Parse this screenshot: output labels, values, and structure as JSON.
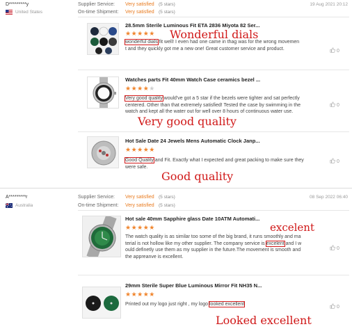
{
  "reviews": [
    {
      "buyer": "D*********y",
      "country": "United States",
      "supplier_label": "Supplier Service:",
      "supplier_value": "Very satisfied",
      "supplier_stars": "(5 stars)",
      "shipment_label": "On-time Shipment:",
      "shipment_value": "Very satisfied",
      "shipment_stars": "(5 stars)",
      "date": "19 Aug 2021 20:12",
      "items": [
        {
          "title": "28.5mm Sterile Luminous Fit ETA 2836 Miyota 82 Ser...",
          "rating": 5,
          "highlight": "wonderful dials",
          "text_after_line1": " fit well! I even had one came in thag was for the wrong movemen",
          "text_line2": "t and they quickly got me a new one! Great customer service and product.",
          "annotation": "Wonderful dials",
          "likes": "0"
        },
        {
          "title": "Watches parts Fit 40mm Watch Case ceramics bezel ...",
          "rating": 4,
          "highlight": "Very good quality",
          "text_after_line1": " would've got a 5 star if the bezels were tighter and sat perfectly",
          "text_line2": "centered. Other than that extremely satisfied! Tested the case by swimming in the",
          "text_line3": "watch and kept all the water out for well over 8 hours of continuous water use.",
          "annotation": "Very good quality",
          "likes": "0"
        },
        {
          "title": "Hot Sale Date 24 Jewels Mens Automatic Clock Janp...",
          "rating": 5,
          "highlight": "Good Quality",
          "text_after_line1": " and Fit. Exactly what I expected and great packing to make sure they",
          "text_line2": "were safe.",
          "annotation": "Good quality",
          "likes": "0"
        }
      ]
    },
    {
      "buyer": "A*********r",
      "country": "Australia",
      "supplier_label": "Supplier Service:",
      "supplier_value": "Very satisfied",
      "supplier_stars": "(5 stars)",
      "shipment_label": "On-time Shipment:",
      "shipment_value": "Very satisfied",
      "shipment_stars": "(5 stars)",
      "date": "08 Sep 2022 06:40",
      "items": [
        {
          "title": "Hot sale 40mm Sapphire glass Date 10ATM Automati...",
          "rating": 5,
          "text_line1": "The watch quality is as similar too some of the big brand, it runs smoothly and ma",
          "text_line2_before": "terial is not hollow like my other supplier. The company service is ",
          "highlight": "excelent",
          "text_line2_after": " and I w",
          "text_line3": "ould definetly use them as my supplier in the future.The movement is smooth and",
          "text_line4": "the appreanve is excellent.",
          "annotation": "excelent",
          "likes": "0"
        },
        {
          "title": "29mm Sterile Super Blue Luminous Mirror Fit NH35 N...",
          "rating": 5,
          "text_before": "Printed out my logo just right , my logo ",
          "highlight": "looked excellent",
          "annotation": "Looked excellent",
          "likes": "0"
        }
      ]
    }
  ]
}
